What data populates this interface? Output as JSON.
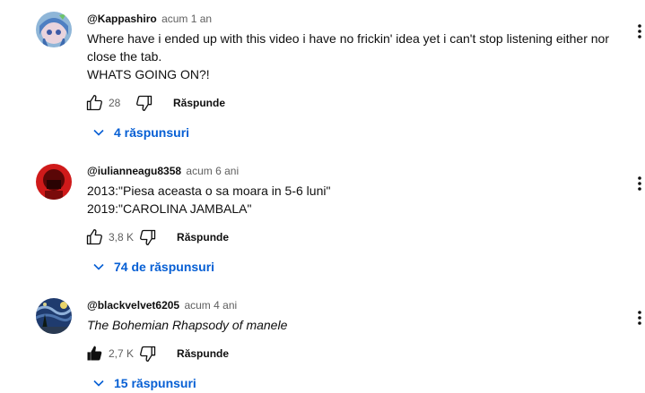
{
  "comments": [
    {
      "author": "@Kappashiro",
      "time": "acum 1 an",
      "text": "Where have i ended up with this video i have no frickin' idea yet i can't stop listening either nor close the tab.\nWHATS GOING ON?!",
      "likes": "28",
      "reply_label": "Răspunde",
      "replies_label": "4 răspunsuri",
      "liked": false
    },
    {
      "author": "@iulianneagu8358",
      "time": "acum 6 ani",
      "text": "2013:\"Piesa aceasta o sa moara in 5-6 luni\"\n2019:\"CAROLINA JAMBALA\"",
      "likes": "3,8 K",
      "reply_label": "Răspunde",
      "replies_label": "74 de răspunsuri",
      "liked": false
    },
    {
      "author": "@blackvelvet6205",
      "time": "acum 4 ani",
      "text": "The Bohemian Rhapsody of manele",
      "likes": "2,7 K",
      "reply_label": "Răspunde",
      "replies_label": "15 răspunsuri",
      "liked": true
    }
  ],
  "icons": {
    "like": "thumbs-up-icon",
    "dislike": "thumbs-down-icon",
    "menu": "more-vertical-icon",
    "chevron": "chevron-down-icon"
  },
  "colors": {
    "link": "#065fd4",
    "secondary_text": "#606060"
  }
}
